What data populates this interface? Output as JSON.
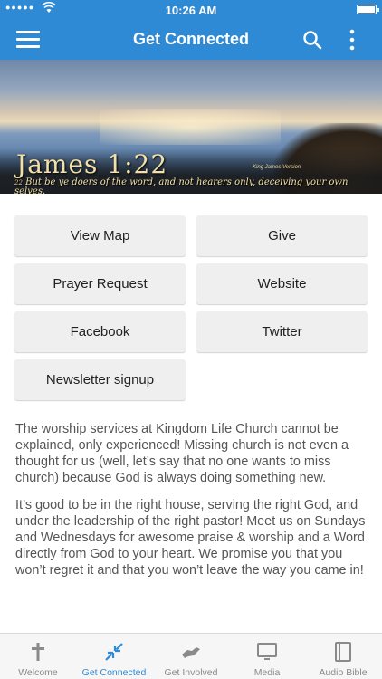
{
  "status_bar": {
    "signal": "●●●●●",
    "time": "10:26 AM"
  },
  "header": {
    "title": "Get Connected"
  },
  "banner": {
    "verse_reference": "James 1:22",
    "version": "King James Version",
    "verse_number": "22",
    "verse_text": "But be ye doers of the word, and not hearers only, deceiving your own selves."
  },
  "buttons": {
    "view_map": "View Map",
    "give": "Give",
    "prayer_request": "Prayer Request",
    "website": "Website",
    "facebook": "Facebook",
    "twitter": "Twitter",
    "newsletter": "Newsletter signup"
  },
  "body": {
    "paragraph_1": "The worship services at Kingdom Life Church cannot be explained, only experienced! Missing church is not even a thought for us (well, let’s say that no one wants to miss church) because God is always doing something new.",
    "paragraph_2": "It’s good to be in the right house, serving the right God, and under the leadership of the right pastor! Meet us on Sundays and Wednesdays for awesome praise & worship and a Word directly from God to your heart. We promise you that you won’t regret it and that you won’t leave the way you came in!"
  },
  "tabs": {
    "welcome": "Welcome",
    "get_connected": "Get Connected",
    "get_involved": "Get Involved",
    "media": "Media",
    "audio_bible": "Audio Bible"
  },
  "colors": {
    "brand_blue": "#2f8ad6",
    "button_bg": "#efefef",
    "text_gray": "#555555"
  }
}
